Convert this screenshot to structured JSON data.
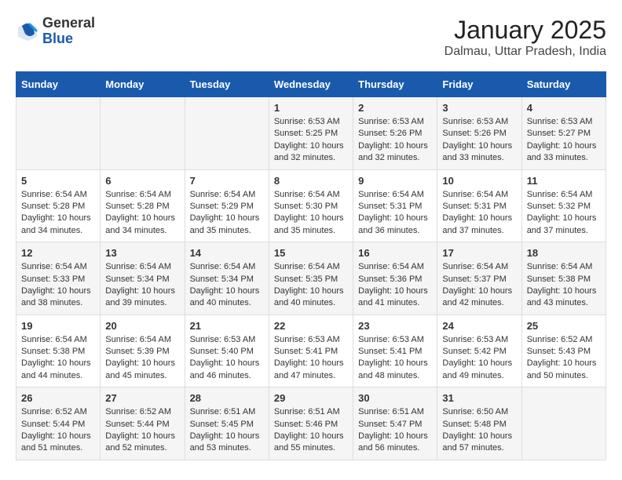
{
  "header": {
    "logo_general": "General",
    "logo_blue": "Blue",
    "month_title": "January 2025",
    "location": "Dalmau, Uttar Pradesh, India"
  },
  "weekdays": [
    "Sunday",
    "Monday",
    "Tuesday",
    "Wednesday",
    "Thursday",
    "Friday",
    "Saturday"
  ],
  "weeks": [
    [
      {
        "day": "",
        "data": ""
      },
      {
        "day": "",
        "data": ""
      },
      {
        "day": "",
        "data": ""
      },
      {
        "day": "1",
        "data": "Sunrise: 6:53 AM\nSunset: 5:25 PM\nDaylight: 10 hours and 32 minutes."
      },
      {
        "day": "2",
        "data": "Sunrise: 6:53 AM\nSunset: 5:26 PM\nDaylight: 10 hours and 32 minutes."
      },
      {
        "day": "3",
        "data": "Sunrise: 6:53 AM\nSunset: 5:26 PM\nDaylight: 10 hours and 33 minutes."
      },
      {
        "day": "4",
        "data": "Sunrise: 6:53 AM\nSunset: 5:27 PM\nDaylight: 10 hours and 33 minutes."
      }
    ],
    [
      {
        "day": "5",
        "data": "Sunrise: 6:54 AM\nSunset: 5:28 PM\nDaylight: 10 hours and 34 minutes."
      },
      {
        "day": "6",
        "data": "Sunrise: 6:54 AM\nSunset: 5:28 PM\nDaylight: 10 hours and 34 minutes."
      },
      {
        "day": "7",
        "data": "Sunrise: 6:54 AM\nSunset: 5:29 PM\nDaylight: 10 hours and 35 minutes."
      },
      {
        "day": "8",
        "data": "Sunrise: 6:54 AM\nSunset: 5:30 PM\nDaylight: 10 hours and 35 minutes."
      },
      {
        "day": "9",
        "data": "Sunrise: 6:54 AM\nSunset: 5:31 PM\nDaylight: 10 hours and 36 minutes."
      },
      {
        "day": "10",
        "data": "Sunrise: 6:54 AM\nSunset: 5:31 PM\nDaylight: 10 hours and 37 minutes."
      },
      {
        "day": "11",
        "data": "Sunrise: 6:54 AM\nSunset: 5:32 PM\nDaylight: 10 hours and 37 minutes."
      }
    ],
    [
      {
        "day": "12",
        "data": "Sunrise: 6:54 AM\nSunset: 5:33 PM\nDaylight: 10 hours and 38 minutes."
      },
      {
        "day": "13",
        "data": "Sunrise: 6:54 AM\nSunset: 5:34 PM\nDaylight: 10 hours and 39 minutes."
      },
      {
        "day": "14",
        "data": "Sunrise: 6:54 AM\nSunset: 5:34 PM\nDaylight: 10 hours and 40 minutes."
      },
      {
        "day": "15",
        "data": "Sunrise: 6:54 AM\nSunset: 5:35 PM\nDaylight: 10 hours and 40 minutes."
      },
      {
        "day": "16",
        "data": "Sunrise: 6:54 AM\nSunset: 5:36 PM\nDaylight: 10 hours and 41 minutes."
      },
      {
        "day": "17",
        "data": "Sunrise: 6:54 AM\nSunset: 5:37 PM\nDaylight: 10 hours and 42 minutes."
      },
      {
        "day": "18",
        "data": "Sunrise: 6:54 AM\nSunset: 5:38 PM\nDaylight: 10 hours and 43 minutes."
      }
    ],
    [
      {
        "day": "19",
        "data": "Sunrise: 6:54 AM\nSunset: 5:38 PM\nDaylight: 10 hours and 44 minutes."
      },
      {
        "day": "20",
        "data": "Sunrise: 6:54 AM\nSunset: 5:39 PM\nDaylight: 10 hours and 45 minutes."
      },
      {
        "day": "21",
        "data": "Sunrise: 6:53 AM\nSunset: 5:40 PM\nDaylight: 10 hours and 46 minutes."
      },
      {
        "day": "22",
        "data": "Sunrise: 6:53 AM\nSunset: 5:41 PM\nDaylight: 10 hours and 47 minutes."
      },
      {
        "day": "23",
        "data": "Sunrise: 6:53 AM\nSunset: 5:41 PM\nDaylight: 10 hours and 48 minutes."
      },
      {
        "day": "24",
        "data": "Sunrise: 6:53 AM\nSunset: 5:42 PM\nDaylight: 10 hours and 49 minutes."
      },
      {
        "day": "25",
        "data": "Sunrise: 6:52 AM\nSunset: 5:43 PM\nDaylight: 10 hours and 50 minutes."
      }
    ],
    [
      {
        "day": "26",
        "data": "Sunrise: 6:52 AM\nSunset: 5:44 PM\nDaylight: 10 hours and 51 minutes."
      },
      {
        "day": "27",
        "data": "Sunrise: 6:52 AM\nSunset: 5:44 PM\nDaylight: 10 hours and 52 minutes."
      },
      {
        "day": "28",
        "data": "Sunrise: 6:51 AM\nSunset: 5:45 PM\nDaylight: 10 hours and 53 minutes."
      },
      {
        "day": "29",
        "data": "Sunrise: 6:51 AM\nSunset: 5:46 PM\nDaylight: 10 hours and 55 minutes."
      },
      {
        "day": "30",
        "data": "Sunrise: 6:51 AM\nSunset: 5:47 PM\nDaylight: 10 hours and 56 minutes."
      },
      {
        "day": "31",
        "data": "Sunrise: 6:50 AM\nSunset: 5:48 PM\nDaylight: 10 hours and 57 minutes."
      },
      {
        "day": "",
        "data": ""
      }
    ]
  ]
}
